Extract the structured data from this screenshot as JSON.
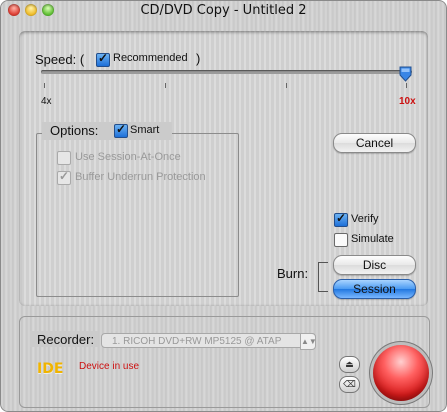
{
  "window": {
    "title": "CD/DVD Copy - Untitled 2"
  },
  "speed": {
    "label": "Speed: (",
    "recommended_label": "Recommended",
    "close_paren": ")",
    "min_label": "4x",
    "max_label": "10x",
    "selected": "10x",
    "recommended_checked": true
  },
  "options": {
    "label": "Options:",
    "smart_label": "Smart",
    "smart_checked": true,
    "session_at_once_label": "Use Session-At-Once",
    "session_at_once_checked": false,
    "buffer_label": "Buffer Underrun Protection",
    "buffer_checked": true
  },
  "actions": {
    "cancel_label": "Cancel",
    "verify_label": "Verify",
    "verify_checked": true,
    "simulate_label": "Simulate",
    "simulate_checked": false,
    "burn_label": "Burn:",
    "disc_label": "Disc",
    "session_label": "Session"
  },
  "recorder": {
    "label": "Recorder:",
    "device": "1. RICOH DVD+RW MP5125 @ ATAP",
    "bus_label": "IDE",
    "status": "Device in use",
    "eject_symbol": "⏏",
    "erase_symbol": "⌫"
  },
  "colors": {
    "accent_blue": "#2278e0",
    "max_speed_red": "#cc1010",
    "ide_yellow": "#f0b400",
    "burn_red": "#d61a1a"
  }
}
